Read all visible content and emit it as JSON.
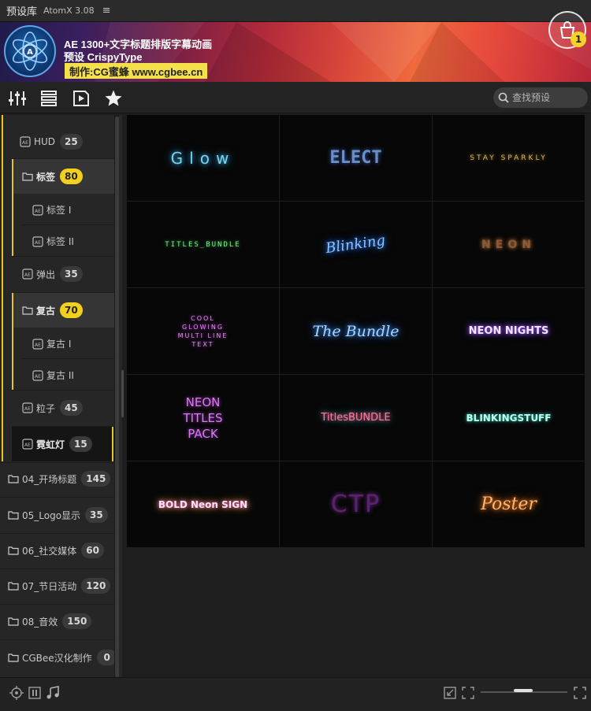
{
  "app": {
    "title": "预设库",
    "version": "AtomX 3.08",
    "menu_icon": "hamburger-icon"
  },
  "banner": {
    "line1": "AE 1300+文字标题排版字幕动画",
    "line2": "预设 CrispyType",
    "credit": "制作:CG蜜蜂 www.cgbee.cn",
    "cart_count": "1"
  },
  "toolbar": {
    "icons": [
      "sliders-icon",
      "list-icon",
      "play-icon",
      "star-icon"
    ],
    "search_placeholder": "查找预设"
  },
  "sidebar": {
    "items": [
      {
        "label": "HUD",
        "count": "25"
      },
      {
        "label": "标签",
        "count": "80"
      },
      {
        "label": "标签 I"
      },
      {
        "label": "标签 II"
      },
      {
        "label": "弹出",
        "count": "35"
      },
      {
        "label": "复古",
        "count": "70"
      },
      {
        "label": "复古 I"
      },
      {
        "label": "复古 II"
      },
      {
        "label": "粒子",
        "count": "45"
      },
      {
        "label": "霓虹灯",
        "count": "15"
      },
      {
        "label": "04_开场标题",
        "count": "145"
      },
      {
        "label": "05_Logo显示",
        "count": "35"
      },
      {
        "label": "06_社交媒体",
        "count": "60"
      },
      {
        "label": "07_节日活动",
        "count": "120"
      },
      {
        "label": "08_音效",
        "count": "150"
      },
      {
        "label": "CGBee汉化制作",
        "count": "0"
      }
    ]
  },
  "grid": {
    "tiles": [
      {
        "text": "Glow",
        "color": "#3aa6c9"
      },
      {
        "text": "ELECT",
        "color": "#5b7fbf"
      },
      {
        "text": "STAY SPARKLY",
        "color": "#c6a23c"
      },
      {
        "text": "TITLES_BUNDLE",
        "color": "#3fd35a"
      },
      {
        "text": "Blinking",
        "color": "#3d8ff0"
      },
      {
        "text": "NEON",
        "color": "#d98a45"
      },
      {
        "text": "COOL GLOWING MULTI LINE TEXT",
        "color": "#c04fd6"
      },
      {
        "text": "The Bundle",
        "color": "#56a9ff"
      },
      {
        "text": "NEON NIGHTS",
        "color": "#a35cff"
      },
      {
        "text": "NEON TITLES PACK",
        "color": "#d94fd1"
      },
      {
        "text": "TitlesBUNDLE",
        "color": "#e0436b"
      },
      {
        "text": "BLINKINGSTUFF",
        "color": "#3ee6c9"
      },
      {
        "text": "BOLD Neon SIGN",
        "color": "#ff5fcf"
      },
      {
        "text": "CTP",
        "color": "#7a2f8e"
      },
      {
        "text": "Poster",
        "color": "#ff9a3c"
      }
    ]
  },
  "footer": {
    "icons": [
      "target-icon",
      "pause-icon",
      "music-note-icon",
      "shrink-icon",
      "fullscreen-icon",
      "expand-icon"
    ]
  }
}
